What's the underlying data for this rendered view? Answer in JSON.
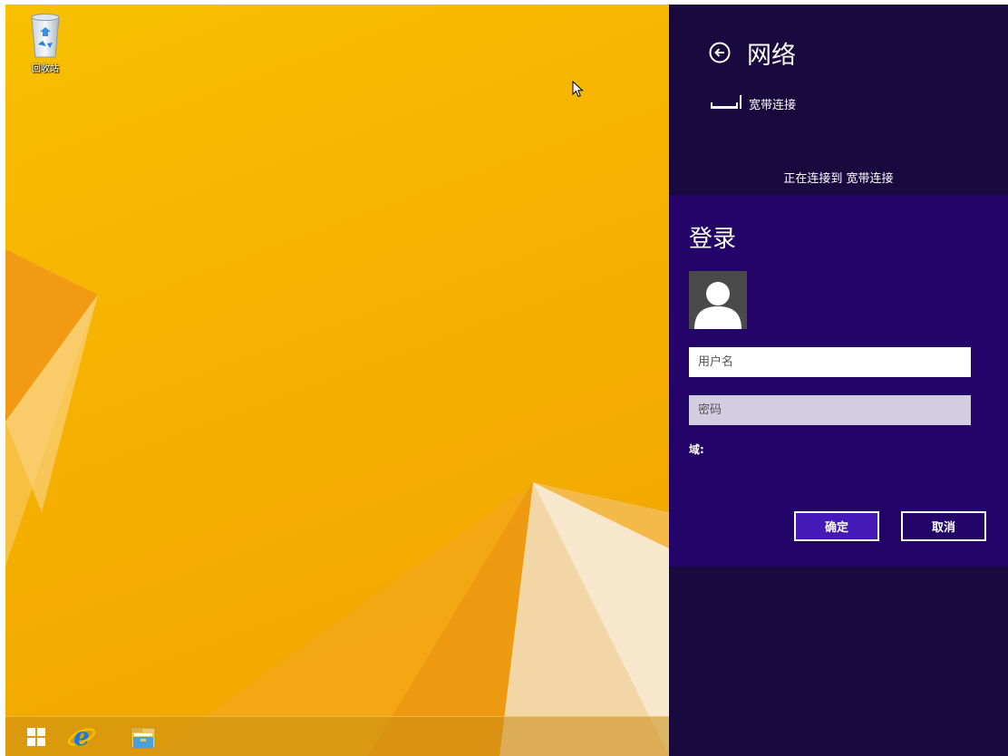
{
  "desktop": {
    "recycle_bin_label": "回收站"
  },
  "taskbar": {
    "items": [
      "start-button",
      "internet-explorer",
      "file-explorer"
    ]
  },
  "network_panel": {
    "title": "网络",
    "connection_name": "宽带连接",
    "status_text": "正在连接到 宽带连接"
  },
  "login": {
    "title": "登录",
    "username_placeholder": "用户名",
    "password_placeholder": "密码",
    "domain_label": "域:",
    "ok_label": "确定",
    "cancel_label": "取消"
  },
  "colors": {
    "panel_background": "#180a3e",
    "login_background": "#230469",
    "ok_button": "#4419b8",
    "desktop_accent": "#f5b100"
  }
}
